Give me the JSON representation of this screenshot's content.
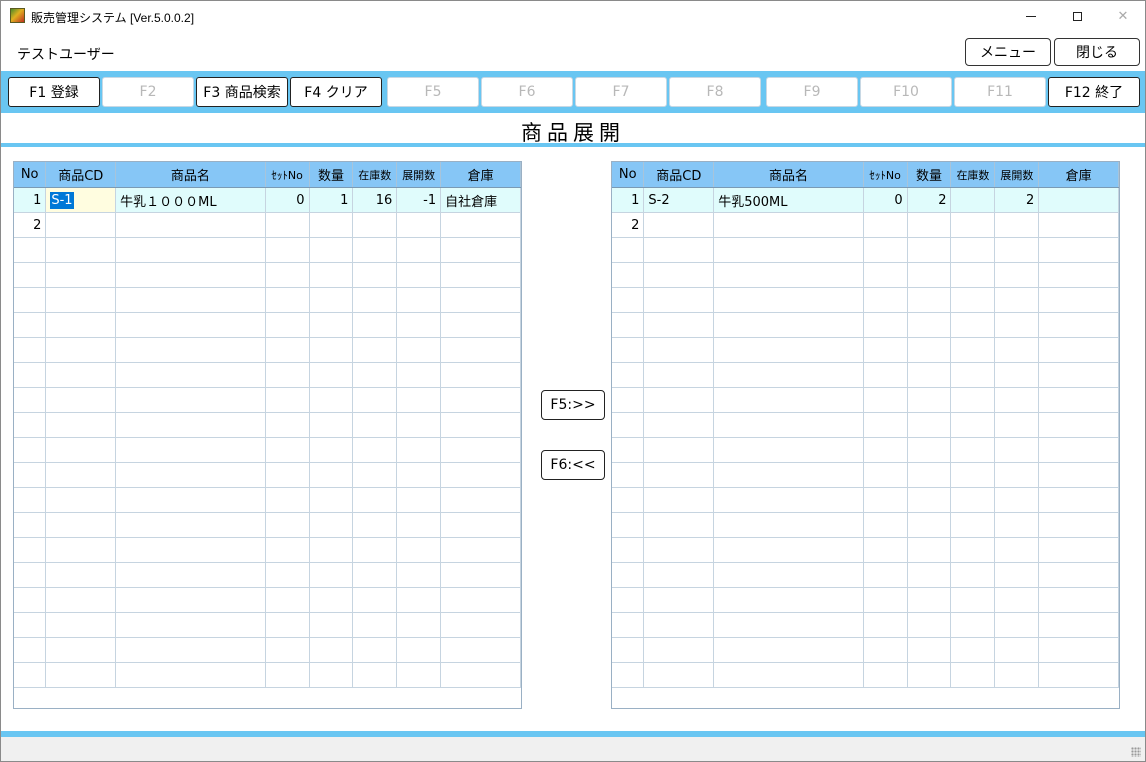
{
  "window": {
    "title": "販売管理システム [Ver.5.0.0.2]",
    "icons": {
      "app": "app-icon",
      "minimize": "minimize-icon",
      "maximize": "maximize-icon",
      "close": "close-icon"
    }
  },
  "header": {
    "user": "テストユーザー",
    "menu_label": "メニュー",
    "close_label": "閉じる"
  },
  "function_keys": [
    {
      "label": "F1 登録",
      "enabled": true
    },
    {
      "label": "F2",
      "enabled": false
    },
    {
      "label": "F3 商品検索",
      "enabled": true
    },
    {
      "label": "F4 クリア",
      "enabled": true
    },
    {
      "label": "F5",
      "enabled": false
    },
    {
      "label": "F6",
      "enabled": false
    },
    {
      "label": "F7",
      "enabled": false
    },
    {
      "label": "F8",
      "enabled": false
    },
    {
      "label": "F9",
      "enabled": false
    },
    {
      "label": "F10",
      "enabled": false
    },
    {
      "label": "F11",
      "enabled": false
    },
    {
      "label": "F12 終了",
      "enabled": true
    }
  ],
  "screen_title": "商品展開",
  "columns": [
    "No",
    "商品CD",
    "商品名",
    "ｾｯﾄNo",
    "数量",
    "在庫数",
    "展開数",
    "倉庫"
  ],
  "left_grid": {
    "rows": [
      [
        "1",
        "S-1",
        "牛乳１０００ML",
        "0",
        "1",
        "16",
        "-1",
        "自社倉庫"
      ],
      [
        "2",
        "",
        "",
        "",
        "",
        "",
        "",
        ""
      ]
    ]
  },
  "right_grid": {
    "rows": [
      [
        "1",
        "S-2",
        "牛乳500ML",
        "0",
        "2",
        "",
        "2",
        ""
      ],
      [
        "2",
        "",
        "",
        "",
        "",
        "",
        "",
        ""
      ]
    ]
  },
  "transfer": {
    "move_right_label": "F5:>>",
    "move_left_label": "F6:<<"
  },
  "colors": {
    "accent": "#69c6f2",
    "grid_header": "#86c6f6",
    "selected_row": "#e0fcfc",
    "edit_cell": "#fffde0",
    "text_selection": "#0078d7"
  }
}
